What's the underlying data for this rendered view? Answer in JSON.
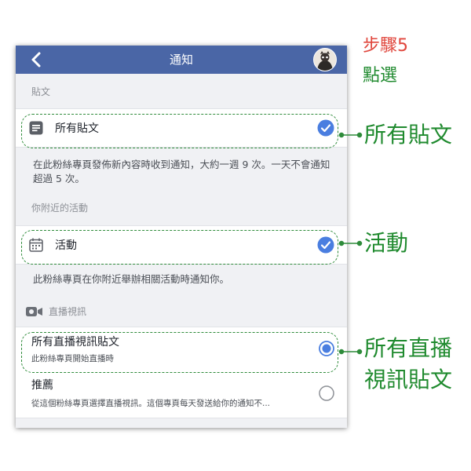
{
  "header": {
    "title": "通知",
    "back": "back"
  },
  "sections": {
    "posts": {
      "label": "貼文",
      "item_label": "所有貼文",
      "description": "在此粉絲專頁發佈新內容時收到通知，大約一週 9 次。一天不會通知超過 5 次。",
      "checked": true
    },
    "nearby": {
      "label": "你附近的活動",
      "item_label": "活動",
      "description": "此粉絲專頁在你附近舉辦相關活動時通知你。",
      "checked": true
    },
    "live": {
      "label": "直播視訊",
      "options": [
        {
          "title": "所有直播視訊貼文",
          "subtitle": "此粉絲專頁開始直播時",
          "selected": true
        },
        {
          "title": "推薦",
          "subtitle": "從這個粉絲專頁選擇直播視訊。這個專頁每天發送給你的通知不...",
          "selected": false
        }
      ]
    }
  },
  "annotations": {
    "step_label": "步驟5",
    "step_action": "點選",
    "callouts": [
      "所有貼文",
      "活動",
      "所有直播",
      "視訊貼文"
    ]
  },
  "colors": {
    "nav_bar": "#4a66a6",
    "accent_blue": "#4a7ee0",
    "callout_green": "#1f8a2e",
    "step_red": "#e0463c"
  }
}
